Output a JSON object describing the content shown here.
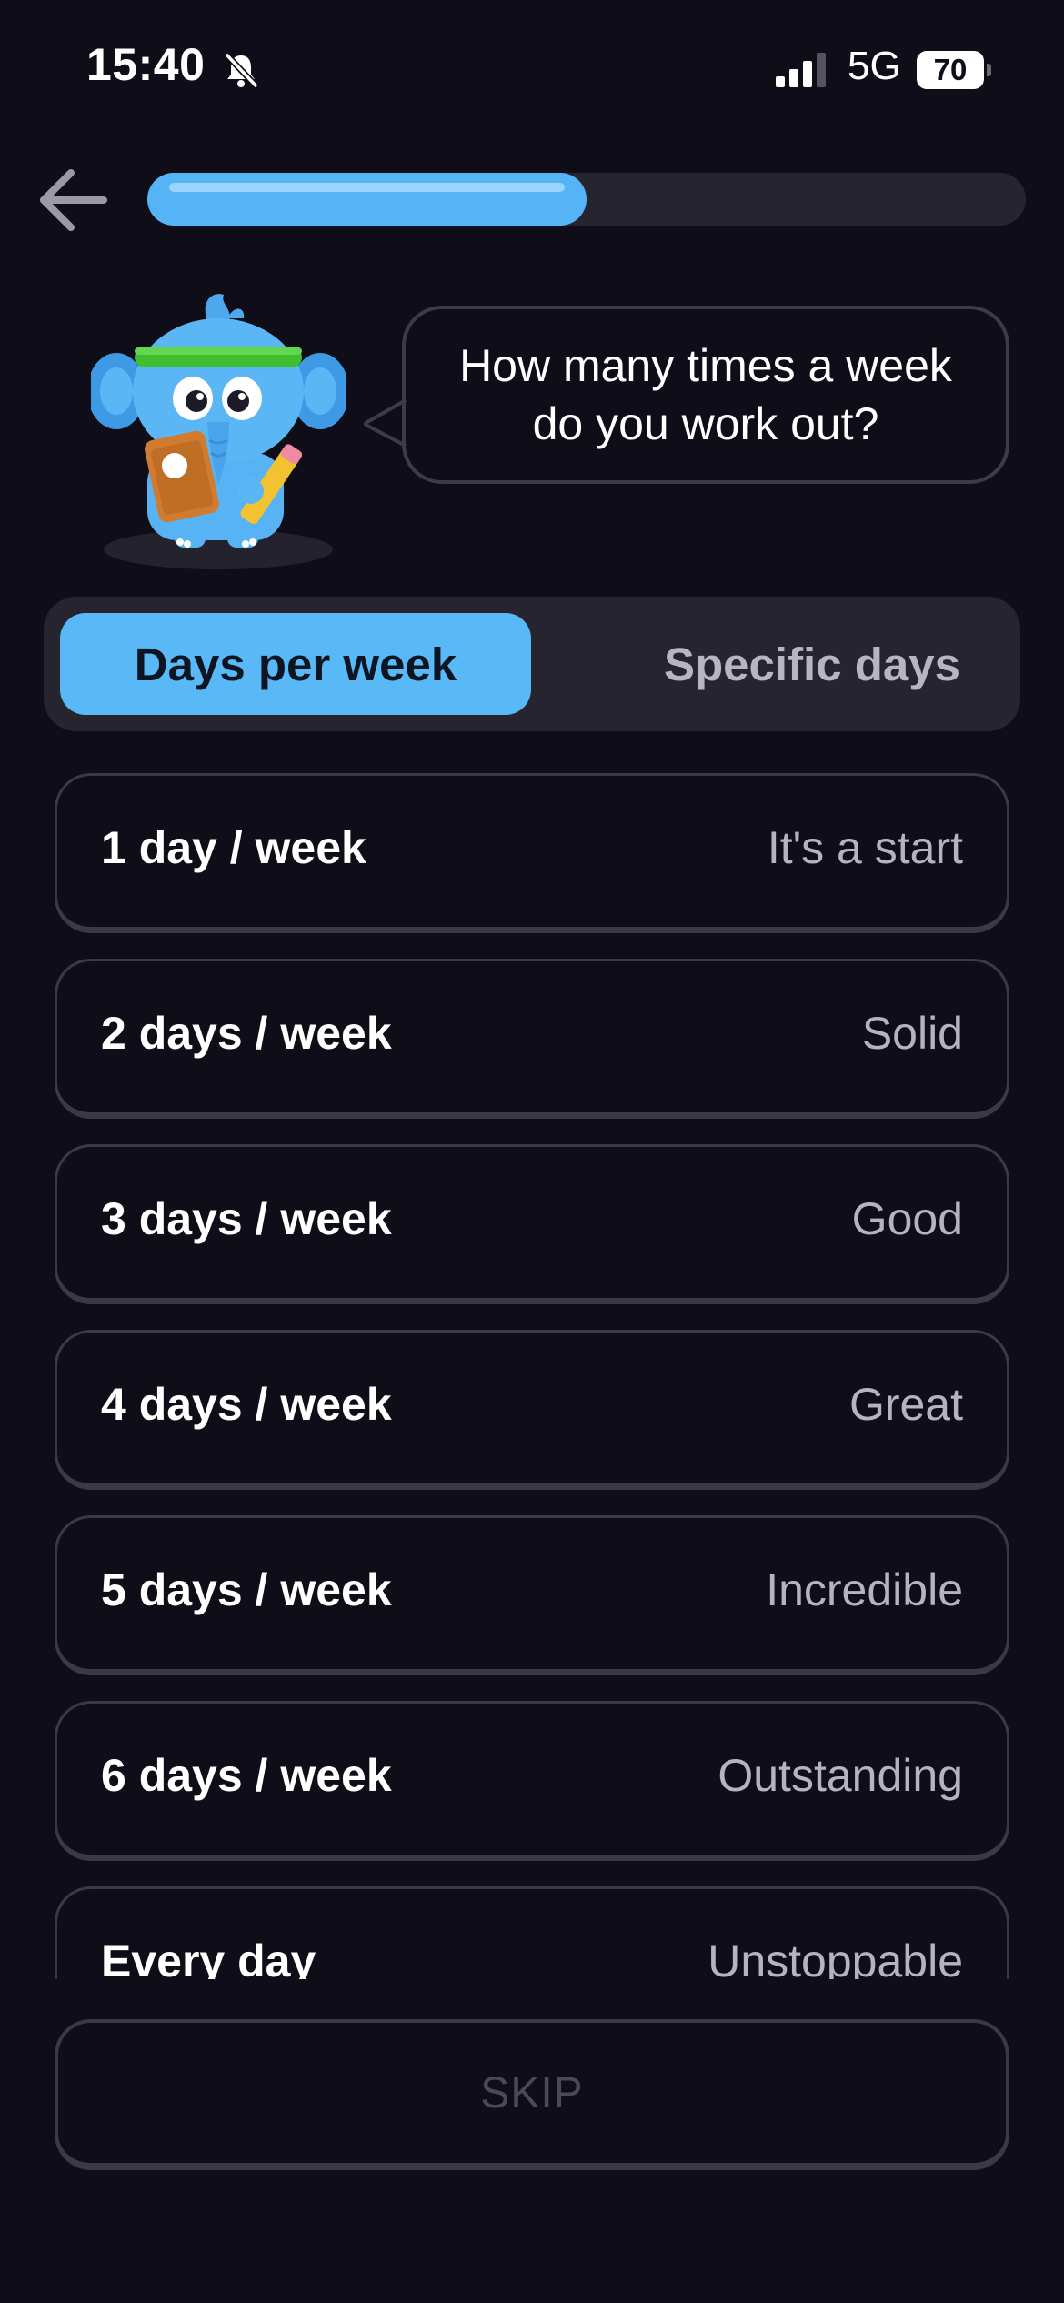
{
  "status_bar": {
    "time": "15:40",
    "network": "5G",
    "battery": "70",
    "icons": [
      "bell-muted-icon",
      "signal-icon",
      "battery-icon"
    ]
  },
  "header": {
    "back_icon": "arrow-left-icon",
    "progress": 0.5
  },
  "mascot": {
    "icon": "elephant-mascot-icon",
    "question": "How many times a week do you work out?"
  },
  "tabs": [
    {
      "label": "Days per week",
      "active": true
    },
    {
      "label": "Specific days",
      "active": false
    }
  ],
  "options": [
    {
      "label": "1 day / week",
      "desc": "It's a start"
    },
    {
      "label": "2 days / week",
      "desc": "Solid"
    },
    {
      "label": "3 days / week",
      "desc": "Good"
    },
    {
      "label": "4 days / week",
      "desc": "Great"
    },
    {
      "label": "5 days / week",
      "desc": "Incredible"
    },
    {
      "label": "6 days / week",
      "desc": "Outstanding"
    },
    {
      "label": "Every day",
      "desc": "Unstoppable"
    }
  ],
  "skip_label": "SKIP",
  "colors": {
    "background": "#0e0d18",
    "accent": "#54b4f5",
    "border": "#3a3945",
    "muted_text": "#b5b4be"
  }
}
